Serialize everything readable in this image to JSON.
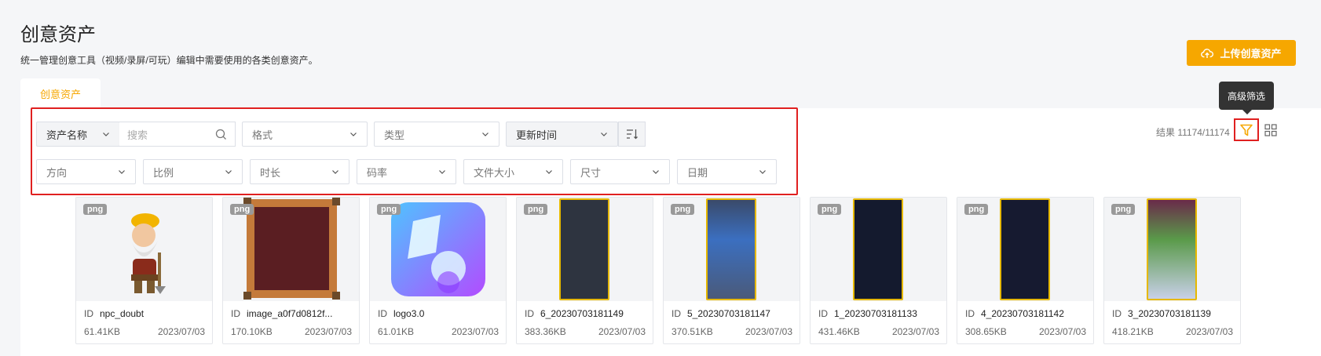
{
  "header": {
    "title": "创意资产",
    "description": "统一管理创意工具（视频/录屏/可玩）编辑中需要使用的各类创意资产。",
    "upload_label": "上传创意资产"
  },
  "tab": {
    "label": "创意资产"
  },
  "tooltip": {
    "text": "高级筛选"
  },
  "filters": {
    "name_select": "资产名称",
    "search_placeholder": "搜索",
    "format": "格式",
    "type": "类型",
    "sort_by": "更新时间",
    "direction": "方向",
    "ratio": "比例",
    "duration": "时长",
    "bitrate": "码率",
    "file_size": "文件大小",
    "dimensions": "尺寸",
    "date": "日期"
  },
  "results": {
    "text": "结果 11174/11174"
  },
  "accent_color": "#f6a700",
  "cards": [
    {
      "badge": "png",
      "id_label": "ID",
      "name": "npc_doubt",
      "size": "61.41KB",
      "date": "2023/07/03"
    },
    {
      "badge": "png",
      "id_label": "ID",
      "name": "image_a0f7d0812f...",
      "size": "170.10KB",
      "date": "2023/07/03"
    },
    {
      "badge": "png",
      "id_label": "ID",
      "name": "logo3.0",
      "size": "61.01KB",
      "date": "2023/07/03"
    },
    {
      "badge": "png",
      "id_label": "ID",
      "name": "6_20230703181149",
      "size": "383.36KB",
      "date": "2023/07/03"
    },
    {
      "badge": "png",
      "id_label": "ID",
      "name": "5_20230703181147",
      "size": "370.51KB",
      "date": "2023/07/03"
    },
    {
      "badge": "png",
      "id_label": "ID",
      "name": "1_20230703181133",
      "size": "431.46KB",
      "date": "2023/07/03"
    },
    {
      "badge": "png",
      "id_label": "ID",
      "name": "4_20230703181142",
      "size": "308.65KB",
      "date": "2023/07/03"
    },
    {
      "badge": "png",
      "id_label": "ID",
      "name": "3_20230703181139",
      "size": "418.21KB",
      "date": "2023/07/03"
    }
  ]
}
